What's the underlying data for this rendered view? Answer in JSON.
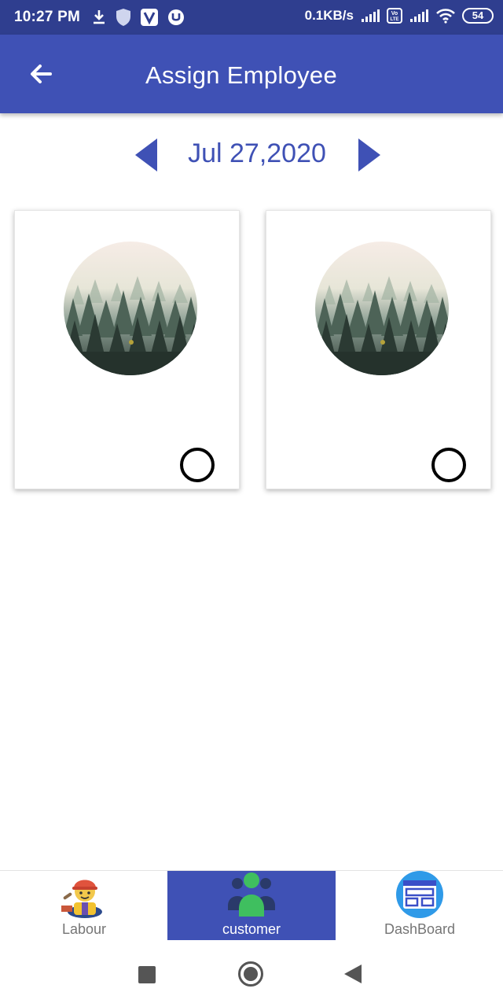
{
  "status_bar": {
    "time": "10:27 PM",
    "net_speed": "0.1KB/s",
    "battery": "54",
    "left_icons": [
      "download-icon",
      "shield-icon",
      "v-app-icon",
      "torrent-icon"
    ],
    "right_icons": [
      "signal-icon",
      "volte-icon",
      "signal-icon",
      "wifi-icon",
      "battery-icon"
    ]
  },
  "app_bar": {
    "title": "Assign Employee",
    "back_icon": "arrow-left-icon",
    "color": "#3f51b5"
  },
  "date_nav": {
    "date": "Jul 27,2020",
    "prev_icon": "triangle-left-icon",
    "next_icon": "triangle-right-icon",
    "color": "#3f51b5"
  },
  "cards": [
    {
      "image": "foggy-forest-avatar",
      "selected": false
    },
    {
      "image": "foggy-forest-avatar",
      "selected": false
    }
  ],
  "bottom_nav": {
    "items": [
      {
        "label": "Labour",
        "icon": "construction-worker-icon",
        "active": false
      },
      {
        "label": "customer",
        "icon": "users-group-icon",
        "active": true
      },
      {
        "label": "DashBoard",
        "icon": "dashboard-icon",
        "active": false
      }
    ],
    "active_color": "#3f51b5"
  },
  "system_nav": {
    "buttons": [
      "recents-button",
      "home-button",
      "back-button"
    ]
  }
}
